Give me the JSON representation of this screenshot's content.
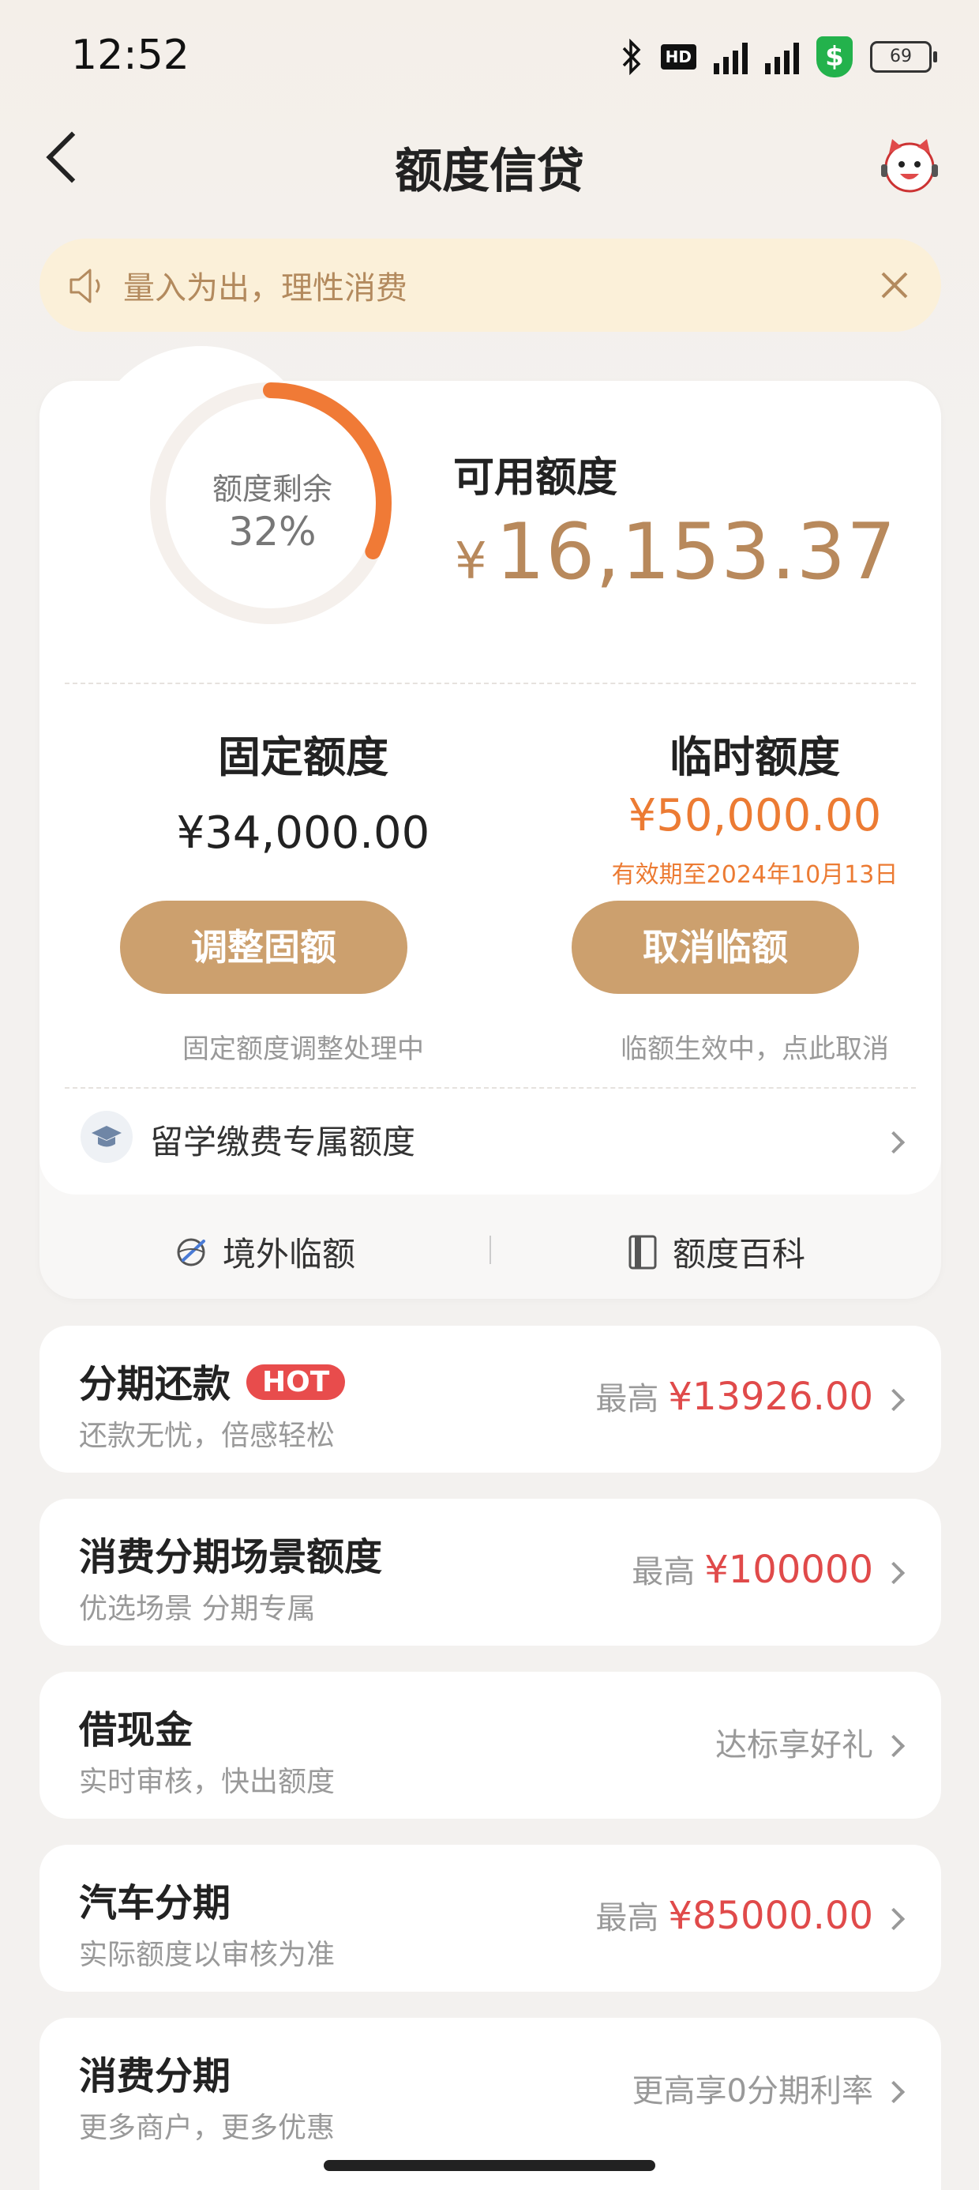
{
  "status": {
    "time": "12:52",
    "battery": "69"
  },
  "header": {
    "title": "额度信贷"
  },
  "notice": {
    "text": "量入为出，理性消费"
  },
  "summary": {
    "ring_label": "额度剩余",
    "ring_percent": "32%",
    "ring_fraction": 0.32,
    "available_label": "可用额度",
    "available_currency": "¥",
    "available_amount": "16,153.37"
  },
  "fixed": {
    "title": "固定额度",
    "amount": "¥34,000.00",
    "button": "调整固额",
    "note": "固定额度调整处理中"
  },
  "temporary": {
    "title": "临时额度",
    "amount": "¥50,000.00",
    "expiry": "有效期至2024年10月13日",
    "button": "取消临额",
    "note": "临额生效中，点此取消"
  },
  "study": {
    "label": "留学缴费专属额度"
  },
  "links": {
    "overseas": "境外临额",
    "wiki": "额度百科"
  },
  "items": [
    {
      "title": "分期还款",
      "badge": "HOT",
      "subtitle": "还款无忧，倍感轻松",
      "prefix": "最高",
      "amount": "¥13926.00"
    },
    {
      "title": "消费分期场景额度",
      "subtitle": "优选场景 分期专属",
      "prefix": "最高",
      "amount": "¥100000"
    },
    {
      "title": "借现金",
      "subtitle": "实时审核，快出额度",
      "right_text": "达标享好礼"
    },
    {
      "title": "汽车分期",
      "subtitle": "实际额度以审核为准",
      "prefix": "最高",
      "amount": "¥85000.00"
    },
    {
      "title": "消费分期",
      "subtitle": "更多商户，更多优惠",
      "right_text": "更高享0分期利率"
    }
  ],
  "colors": {
    "accent": "#cca06e",
    "gold_text": "#b8895c",
    "orange": "#ec7b33",
    "red": "#e04a4a"
  }
}
